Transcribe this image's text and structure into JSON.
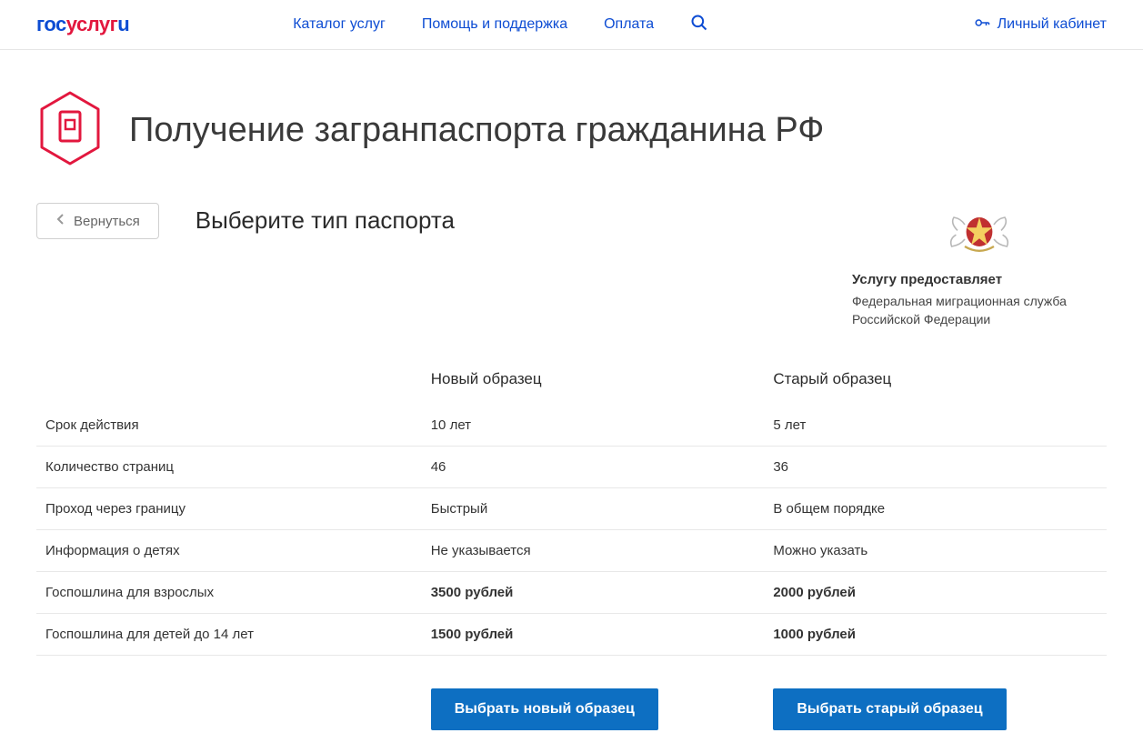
{
  "header": {
    "logo": {
      "part1": "гос",
      "part2": "услуг",
      "part3": "u"
    },
    "nav": {
      "catalog": "Каталог услуг",
      "help": "Помощь и поддержка",
      "payment": "Оплата"
    },
    "cabinet": "Личный кабинет"
  },
  "page": {
    "title": "Получение загранпаспорта гражданина РФ",
    "back_label": "Вернуться",
    "subtitle": "Выберите тип паспорта"
  },
  "provider": {
    "label": "Услугу предоставляет",
    "name": "Федеральная миграционная служба Российской Федерации"
  },
  "table": {
    "headers": {
      "attr": "",
      "new": "Новый образец",
      "old": "Старый образец"
    },
    "rows": [
      {
        "attr": "Срок действия",
        "new": "10 лет",
        "old": "5 лет",
        "bold": false
      },
      {
        "attr": "Количество страниц",
        "new": "46",
        "old": "36",
        "bold": false
      },
      {
        "attr": "Проход через границу",
        "new": "Быстрый",
        "old": "В общем порядке",
        "bold": false
      },
      {
        "attr": "Информация о детях",
        "new": "Не указывается",
        "old": "Можно указать",
        "bold": false
      },
      {
        "attr": "Госпошлина для взрослых",
        "new": "3500 рублей",
        "old": "2000 рублей",
        "bold": true
      },
      {
        "attr": "Госпошлина для детей до 14 лет",
        "new": "1500 рублей",
        "old": "1000 рублей",
        "bold": true
      }
    ]
  },
  "buttons": {
    "choose_new": "Выбрать новый образец",
    "choose_old": "Выбрать старый образец"
  }
}
